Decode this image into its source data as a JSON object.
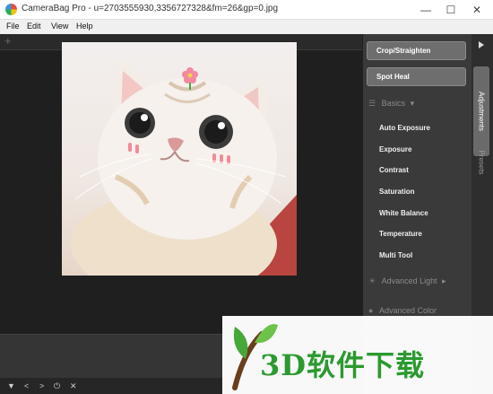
{
  "window": {
    "title": "CameraBag Pro - u=2703555930,3356727328&fm=26&gp=0.jpg",
    "min_glyph": "—",
    "max_glyph": "☐",
    "close_glyph": "✕"
  },
  "menu": [
    "File",
    "Edit",
    "View",
    "Help"
  ],
  "canvas": {
    "add_glyph": "+"
  },
  "panel": {
    "buttons": [
      "Crop/Straighten",
      "Spot Heal"
    ],
    "basics_label": "Basics",
    "adjustments": [
      "Auto Exposure",
      "Exposure",
      "Contrast",
      "Saturation",
      "White Balance",
      "Temperature",
      "Multi Tool"
    ],
    "advanced_light_label": "Advanced Light",
    "advanced_color_label": "Advanced Color"
  },
  "tabs": {
    "adjustments": "Adjustments",
    "presets": "Presets"
  },
  "bottom_bar": {
    "icons": [
      "▼",
      "<",
      ">",
      "⏻",
      "✕"
    ]
  },
  "watermark": {
    "text": "3D软件下载"
  },
  "colors": {
    "panel_bg": "#3a3a3a",
    "canvas_bg": "#1f1f1f",
    "button_bg": "#6e6e6e",
    "watermark_green": "#2b9a2f"
  }
}
